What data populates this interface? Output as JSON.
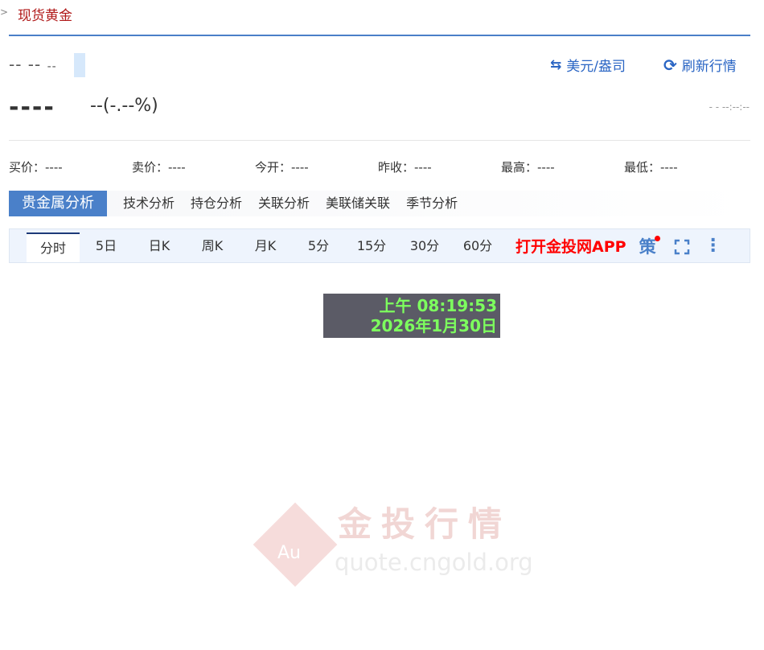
{
  "breadcrumb": {
    "arrow": ">",
    "title": "现货黄金"
  },
  "quote": {
    "date_placeholder": "-- --",
    "date_small": "--",
    "price": "----",
    "change": "--(-.--%)",
    "time": "- - --:--:--"
  },
  "actions": {
    "unit": "美元/盎司",
    "refresh": "刷新行情"
  },
  "stats": [
    {
      "label": "买价：----"
    },
    {
      "label": "卖价：----"
    },
    {
      "label": "今开：----"
    },
    {
      "label": "昨收：----"
    },
    {
      "label": "最高：----"
    },
    {
      "label": "最低：----"
    }
  ],
  "tabs": [
    "贵金属分析",
    "技术分析",
    "持仓分析",
    "关联分析",
    "美联储关联",
    "季节分析"
  ],
  "periods": [
    "分时",
    "5日",
    "日K",
    "周K",
    "月K",
    "5分",
    "15分",
    "30分",
    "60分"
  ],
  "toolbar": {
    "app": "打开金投网APP",
    "strategy": "策"
  },
  "overlay": {
    "time": "上午 08:19:53",
    "date": "2026年1月30日"
  },
  "watermark": {
    "name": "金投行情",
    "url": "quote.cngold.org",
    "logo": "Au"
  },
  "colors": {
    "accent": "#4a80c9",
    "red": "#ff0000",
    "overlay_text": "#7dff5e"
  }
}
